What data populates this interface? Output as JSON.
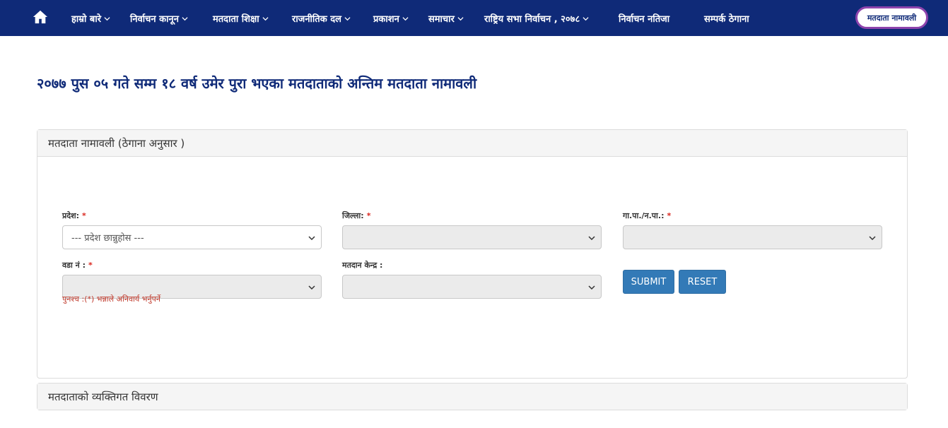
{
  "nav": {
    "items": [
      {
        "label": "हाम्रो बारे",
        "dropdown": true
      },
      {
        "label": "निर्वाचन कानून",
        "dropdown": true
      },
      {
        "label": "मतदाता शिक्षा",
        "dropdown": true
      },
      {
        "label": "राजनीतिक दल",
        "dropdown": true
      },
      {
        "label": "प्रकाशन",
        "dropdown": true
      },
      {
        "label": "समाचार",
        "dropdown": true
      },
      {
        "label": "राष्ट्रिय सभा निर्वाचन , २०७८",
        "dropdown": true
      },
      {
        "label": "निर्वाचन नतिजा",
        "dropdown": false
      },
      {
        "label": "सम्पर्क ठेगाना",
        "dropdown": false
      }
    ],
    "voter_list_button": "मतदाता नामावली"
  },
  "page": {
    "title": "२०७७ पुस ०५ गते सम्म १८ वर्ष उमेर पुरा भएका मतदाताको अन्तिम मतदाता नामावली"
  },
  "search_panel": {
    "heading": "मतदाता नामावली (ठेगाना अनुसार )",
    "fields": {
      "province": {
        "label": "प्रदेश:",
        "required": "*",
        "value": "--- प्रदेश छान्नुहोस ---"
      },
      "district": {
        "label": "जिल्ला:",
        "required": "*",
        "value": ""
      },
      "municipality": {
        "label": "गा.पा./न.पा.:",
        "required": "*",
        "value": ""
      },
      "ward": {
        "label": "वडा नं :",
        "required": "*",
        "value": ""
      },
      "polling_center": {
        "label": "मतदान केन्द्र :",
        "value": ""
      }
    },
    "submit_label": "SUBMIT",
    "reset_label": "RESET",
    "note": "पुनश्च :(*) भन्नाले अनिवार्य भर्नुपर्ने"
  },
  "details_panel": {
    "heading": "मतदाताको व्यक्तिगत विवरण"
  },
  "colors": {
    "nav_bg": "#0f2a78",
    "title": "#0f2a78",
    "button": "#337ab7",
    "required": "#d9251d",
    "voter_button_border": "#8e44ad"
  }
}
